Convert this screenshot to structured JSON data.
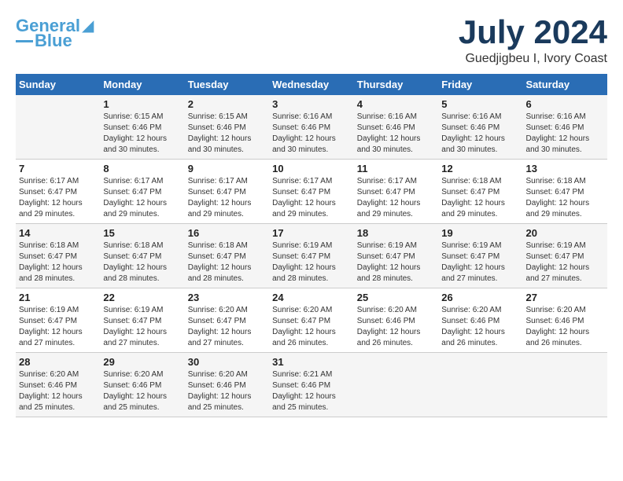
{
  "logo": {
    "line1": "General",
    "line2": "Blue"
  },
  "title": "July 2024",
  "location": "Guedjigbeu I, Ivory Coast",
  "days_of_week": [
    "Sunday",
    "Monday",
    "Tuesday",
    "Wednesday",
    "Thursday",
    "Friday",
    "Saturday"
  ],
  "weeks": [
    [
      {
        "num": "",
        "info": ""
      },
      {
        "num": "1",
        "info": "Sunrise: 6:15 AM\nSunset: 6:46 PM\nDaylight: 12 hours\nand 30 minutes."
      },
      {
        "num": "2",
        "info": "Sunrise: 6:15 AM\nSunset: 6:46 PM\nDaylight: 12 hours\nand 30 minutes."
      },
      {
        "num": "3",
        "info": "Sunrise: 6:16 AM\nSunset: 6:46 PM\nDaylight: 12 hours\nand 30 minutes."
      },
      {
        "num": "4",
        "info": "Sunrise: 6:16 AM\nSunset: 6:46 PM\nDaylight: 12 hours\nand 30 minutes."
      },
      {
        "num": "5",
        "info": "Sunrise: 6:16 AM\nSunset: 6:46 PM\nDaylight: 12 hours\nand 30 minutes."
      },
      {
        "num": "6",
        "info": "Sunrise: 6:16 AM\nSunset: 6:46 PM\nDaylight: 12 hours\nand 30 minutes."
      }
    ],
    [
      {
        "num": "7",
        "info": "Sunrise: 6:17 AM\nSunset: 6:47 PM\nDaylight: 12 hours\nand 29 minutes."
      },
      {
        "num": "8",
        "info": "Sunrise: 6:17 AM\nSunset: 6:47 PM\nDaylight: 12 hours\nand 29 minutes."
      },
      {
        "num": "9",
        "info": "Sunrise: 6:17 AM\nSunset: 6:47 PM\nDaylight: 12 hours\nand 29 minutes."
      },
      {
        "num": "10",
        "info": "Sunrise: 6:17 AM\nSunset: 6:47 PM\nDaylight: 12 hours\nand 29 minutes."
      },
      {
        "num": "11",
        "info": "Sunrise: 6:17 AM\nSunset: 6:47 PM\nDaylight: 12 hours\nand 29 minutes."
      },
      {
        "num": "12",
        "info": "Sunrise: 6:18 AM\nSunset: 6:47 PM\nDaylight: 12 hours\nand 29 minutes."
      },
      {
        "num": "13",
        "info": "Sunrise: 6:18 AM\nSunset: 6:47 PM\nDaylight: 12 hours\nand 29 minutes."
      }
    ],
    [
      {
        "num": "14",
        "info": "Sunrise: 6:18 AM\nSunset: 6:47 PM\nDaylight: 12 hours\nand 28 minutes."
      },
      {
        "num": "15",
        "info": "Sunrise: 6:18 AM\nSunset: 6:47 PM\nDaylight: 12 hours\nand 28 minutes."
      },
      {
        "num": "16",
        "info": "Sunrise: 6:18 AM\nSunset: 6:47 PM\nDaylight: 12 hours\nand 28 minutes."
      },
      {
        "num": "17",
        "info": "Sunrise: 6:19 AM\nSunset: 6:47 PM\nDaylight: 12 hours\nand 28 minutes."
      },
      {
        "num": "18",
        "info": "Sunrise: 6:19 AM\nSunset: 6:47 PM\nDaylight: 12 hours\nand 28 minutes."
      },
      {
        "num": "19",
        "info": "Sunrise: 6:19 AM\nSunset: 6:47 PM\nDaylight: 12 hours\nand 27 minutes."
      },
      {
        "num": "20",
        "info": "Sunrise: 6:19 AM\nSunset: 6:47 PM\nDaylight: 12 hours\nand 27 minutes."
      }
    ],
    [
      {
        "num": "21",
        "info": "Sunrise: 6:19 AM\nSunset: 6:47 PM\nDaylight: 12 hours\nand 27 minutes."
      },
      {
        "num": "22",
        "info": "Sunrise: 6:19 AM\nSunset: 6:47 PM\nDaylight: 12 hours\nand 27 minutes."
      },
      {
        "num": "23",
        "info": "Sunrise: 6:20 AM\nSunset: 6:47 PM\nDaylight: 12 hours\nand 27 minutes."
      },
      {
        "num": "24",
        "info": "Sunrise: 6:20 AM\nSunset: 6:47 PM\nDaylight: 12 hours\nand 26 minutes."
      },
      {
        "num": "25",
        "info": "Sunrise: 6:20 AM\nSunset: 6:46 PM\nDaylight: 12 hours\nand 26 minutes."
      },
      {
        "num": "26",
        "info": "Sunrise: 6:20 AM\nSunset: 6:46 PM\nDaylight: 12 hours\nand 26 minutes."
      },
      {
        "num": "27",
        "info": "Sunrise: 6:20 AM\nSunset: 6:46 PM\nDaylight: 12 hours\nand 26 minutes."
      }
    ],
    [
      {
        "num": "28",
        "info": "Sunrise: 6:20 AM\nSunset: 6:46 PM\nDaylight: 12 hours\nand 25 minutes."
      },
      {
        "num": "29",
        "info": "Sunrise: 6:20 AM\nSunset: 6:46 PM\nDaylight: 12 hours\nand 25 minutes."
      },
      {
        "num": "30",
        "info": "Sunrise: 6:20 AM\nSunset: 6:46 PM\nDaylight: 12 hours\nand 25 minutes."
      },
      {
        "num": "31",
        "info": "Sunrise: 6:21 AM\nSunset: 6:46 PM\nDaylight: 12 hours\nand 25 minutes."
      },
      {
        "num": "",
        "info": ""
      },
      {
        "num": "",
        "info": ""
      },
      {
        "num": "",
        "info": ""
      }
    ]
  ]
}
